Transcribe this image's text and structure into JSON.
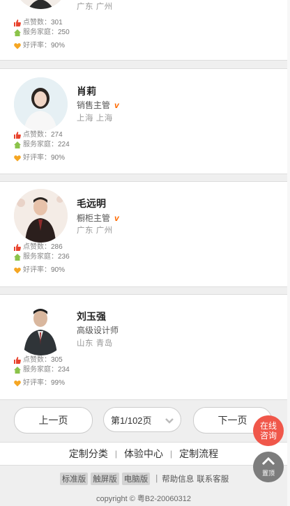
{
  "experts": [
    {
      "name": "",
      "title": "",
      "location": "广东  广州",
      "likes_label": "点赞数：",
      "likes": "301",
      "served_label": "服务家庭：",
      "served": "250",
      "rating_label": "好评率：",
      "rating": "90%",
      "verified": false
    },
    {
      "name": "肖莉",
      "title": "销售主管",
      "location": "上海  上海",
      "likes_label": "点赞数：",
      "likes": "274",
      "served_label": "服务家庭：",
      "served": "224",
      "rating_label": "好评率：",
      "rating": "90%",
      "verified": true
    },
    {
      "name": "毛远明",
      "title": "橱柜主管",
      "location": "广东  广州",
      "likes_label": "点赞数：",
      "likes": "286",
      "served_label": "服务家庭：",
      "served": "236",
      "rating_label": "好评率：",
      "rating": "90%",
      "verified": true
    },
    {
      "name": "刘玉强",
      "title": "高级设计师",
      "location": "山东  青岛",
      "likes_label": "点赞数：",
      "likes": "305",
      "served_label": "服务家庭：",
      "served": "234",
      "rating_label": "好评率：",
      "rating": "99%",
      "verified": false
    }
  ],
  "verified_badge": "v",
  "pagination": {
    "prev": "上一页",
    "current": "第1/102页",
    "next": "下一页"
  },
  "float": {
    "chat_line1": "在线",
    "chat_line2": "咨询",
    "top_label": "置顶"
  },
  "footer_nav": [
    "定制分类",
    "体验中心",
    "定制流程"
  ],
  "footer_sep": "|",
  "versions": [
    "标准版",
    "触屏版",
    "电脑版"
  ],
  "version_sep": "|",
  "footer_links": [
    "帮助信息",
    "联系客服"
  ],
  "copyright": "copyright © 粤B2-20060312",
  "colors": {
    "like": "#e8442e",
    "served": "#8bc34a",
    "rating": "#f5a623",
    "badge": "#ff6a00",
    "chat_btn": "#f0574a",
    "top_btn": "#7d7d7d"
  }
}
